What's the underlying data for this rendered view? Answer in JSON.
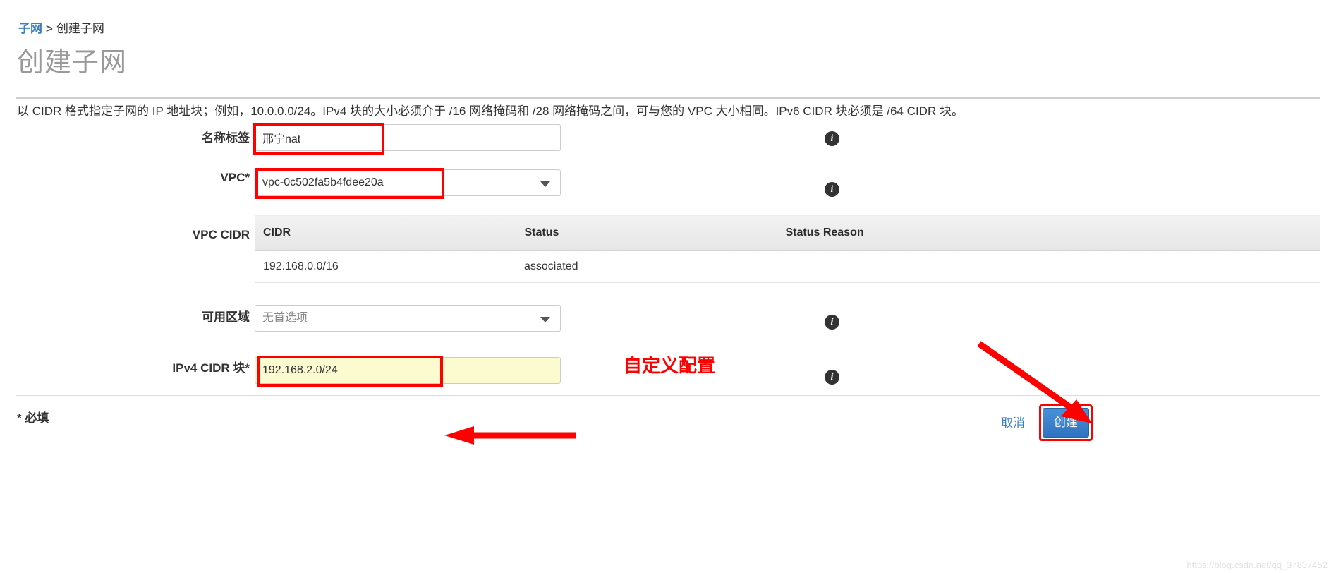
{
  "breadcrumb": {
    "link": "子网",
    "separator": ">",
    "current": "创建子网"
  },
  "page_title": "创建子网",
  "description": "以 CIDR 格式指定子网的 IP 地址块；例如，10.0.0.0/24。IPv4 块的大小必须介于 /16 网络掩码和 /28 网络掩码之间，可与您的 VPC 大小相同。IPv6 CIDR 块必须是 /64 CIDR 块。",
  "form": {
    "name_tag": {
      "label": "名称标签",
      "value": "邢宁nat",
      "info_icon": "info-icon"
    },
    "vpc": {
      "label": "VPC*",
      "value": "vpc-0c502fa5b4fdee20a",
      "info_icon": "info-icon",
      "caret_icon": "chevron-down-icon"
    },
    "vpc_cidr": {
      "label": "VPC CIDR",
      "columns": [
        "CIDR",
        "Status",
        "Status Reason",
        ""
      ],
      "rows": [
        {
          "cidr": "192.168.0.0/16",
          "status": "associated",
          "status_reason": "",
          "extra": ""
        }
      ]
    },
    "availability_zone": {
      "label": "可用区域",
      "value": "无首选项",
      "info_icon": "info-icon",
      "caret_icon": "chevron-down-icon"
    },
    "ipv4_cidr": {
      "label": "IPv4 CIDR 块*",
      "value": "192.168.2.0/24",
      "info_icon": "info-icon"
    }
  },
  "annotations": {
    "ipv4_note": "自定义配置",
    "highlight_color": "#ff0000",
    "highlight_fill": "#fcfbd0"
  },
  "footer": {
    "required_note": "* 必填",
    "cancel_label": "取消",
    "create_label": "创建"
  },
  "watermark": "https://blog.csdn.net/qq_37837452",
  "colors": {
    "link_blue": "#3b7fc4",
    "status_green": "#1a9d2e",
    "button_blue": "#2f73c0",
    "annotation_red": "#ff0000",
    "title_gray": "#999999"
  }
}
